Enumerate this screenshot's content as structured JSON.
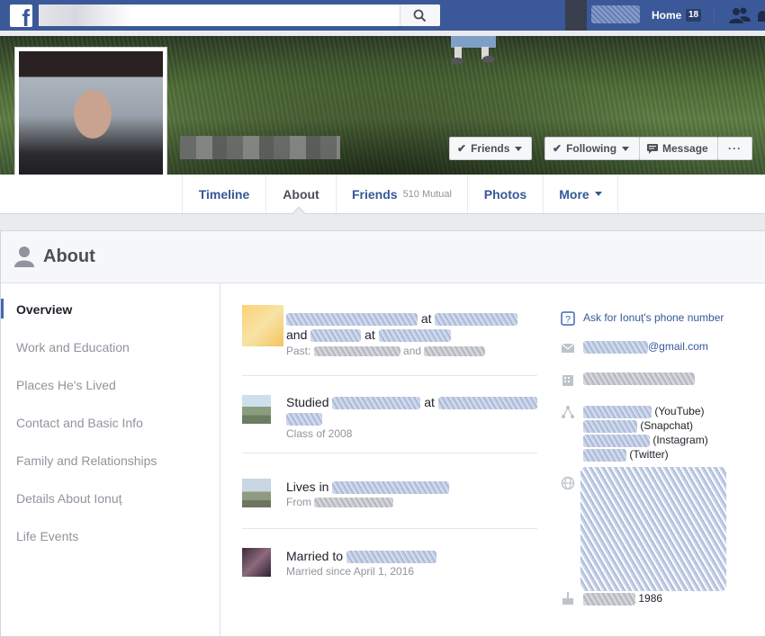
{
  "topbar": {
    "logo_letter": "f",
    "search_placeholder": "",
    "home_label": "Home",
    "home_count": "18",
    "icons": [
      "search-icon",
      "friend-requests-icon",
      "messages-icon"
    ]
  },
  "profile": {
    "buttons": {
      "friends": "Friends",
      "following": "Following",
      "message": "Message",
      "more": "···"
    },
    "tabs": [
      {
        "label": "Timeline",
        "sub": ""
      },
      {
        "label": "About",
        "sub": ""
      },
      {
        "label": "Friends",
        "sub": "510 Mutual"
      },
      {
        "label": "Photos",
        "sub": ""
      },
      {
        "label": "More",
        "sub": ""
      }
    ]
  },
  "about": {
    "title": "About",
    "nav": [
      "Overview",
      "Work and Education",
      "Places He's Lived",
      "Contact and Basic Info",
      "Family and Relationships",
      "Details About Ionuț",
      "Life Events"
    ],
    "overview": {
      "work": {
        "at1": "at",
        "and": "and",
        "at2": "at",
        "past_prefix": "Past:",
        "past_and": "and"
      },
      "education": {
        "prefix": "Studied",
        "at": "at",
        "sub": "Class of 2008"
      },
      "lives": {
        "prefix": "Lives in",
        "from": "From"
      },
      "married": {
        "prefix": "Married to",
        "sub": "Married since April 1, 2016"
      }
    },
    "contact": {
      "phone_link": "Ask for Ionuț's phone number",
      "email_suffix": "@gmail.com",
      "youtube": "(YouTube)",
      "snapchat": "(Snapchat)",
      "instagram": "(Instagram)",
      "twitter": "(Twitter)",
      "birth_year": "1986"
    }
  },
  "colors": {
    "brand": "#3b5998",
    "link": "#365899",
    "muted": "#90949c"
  }
}
